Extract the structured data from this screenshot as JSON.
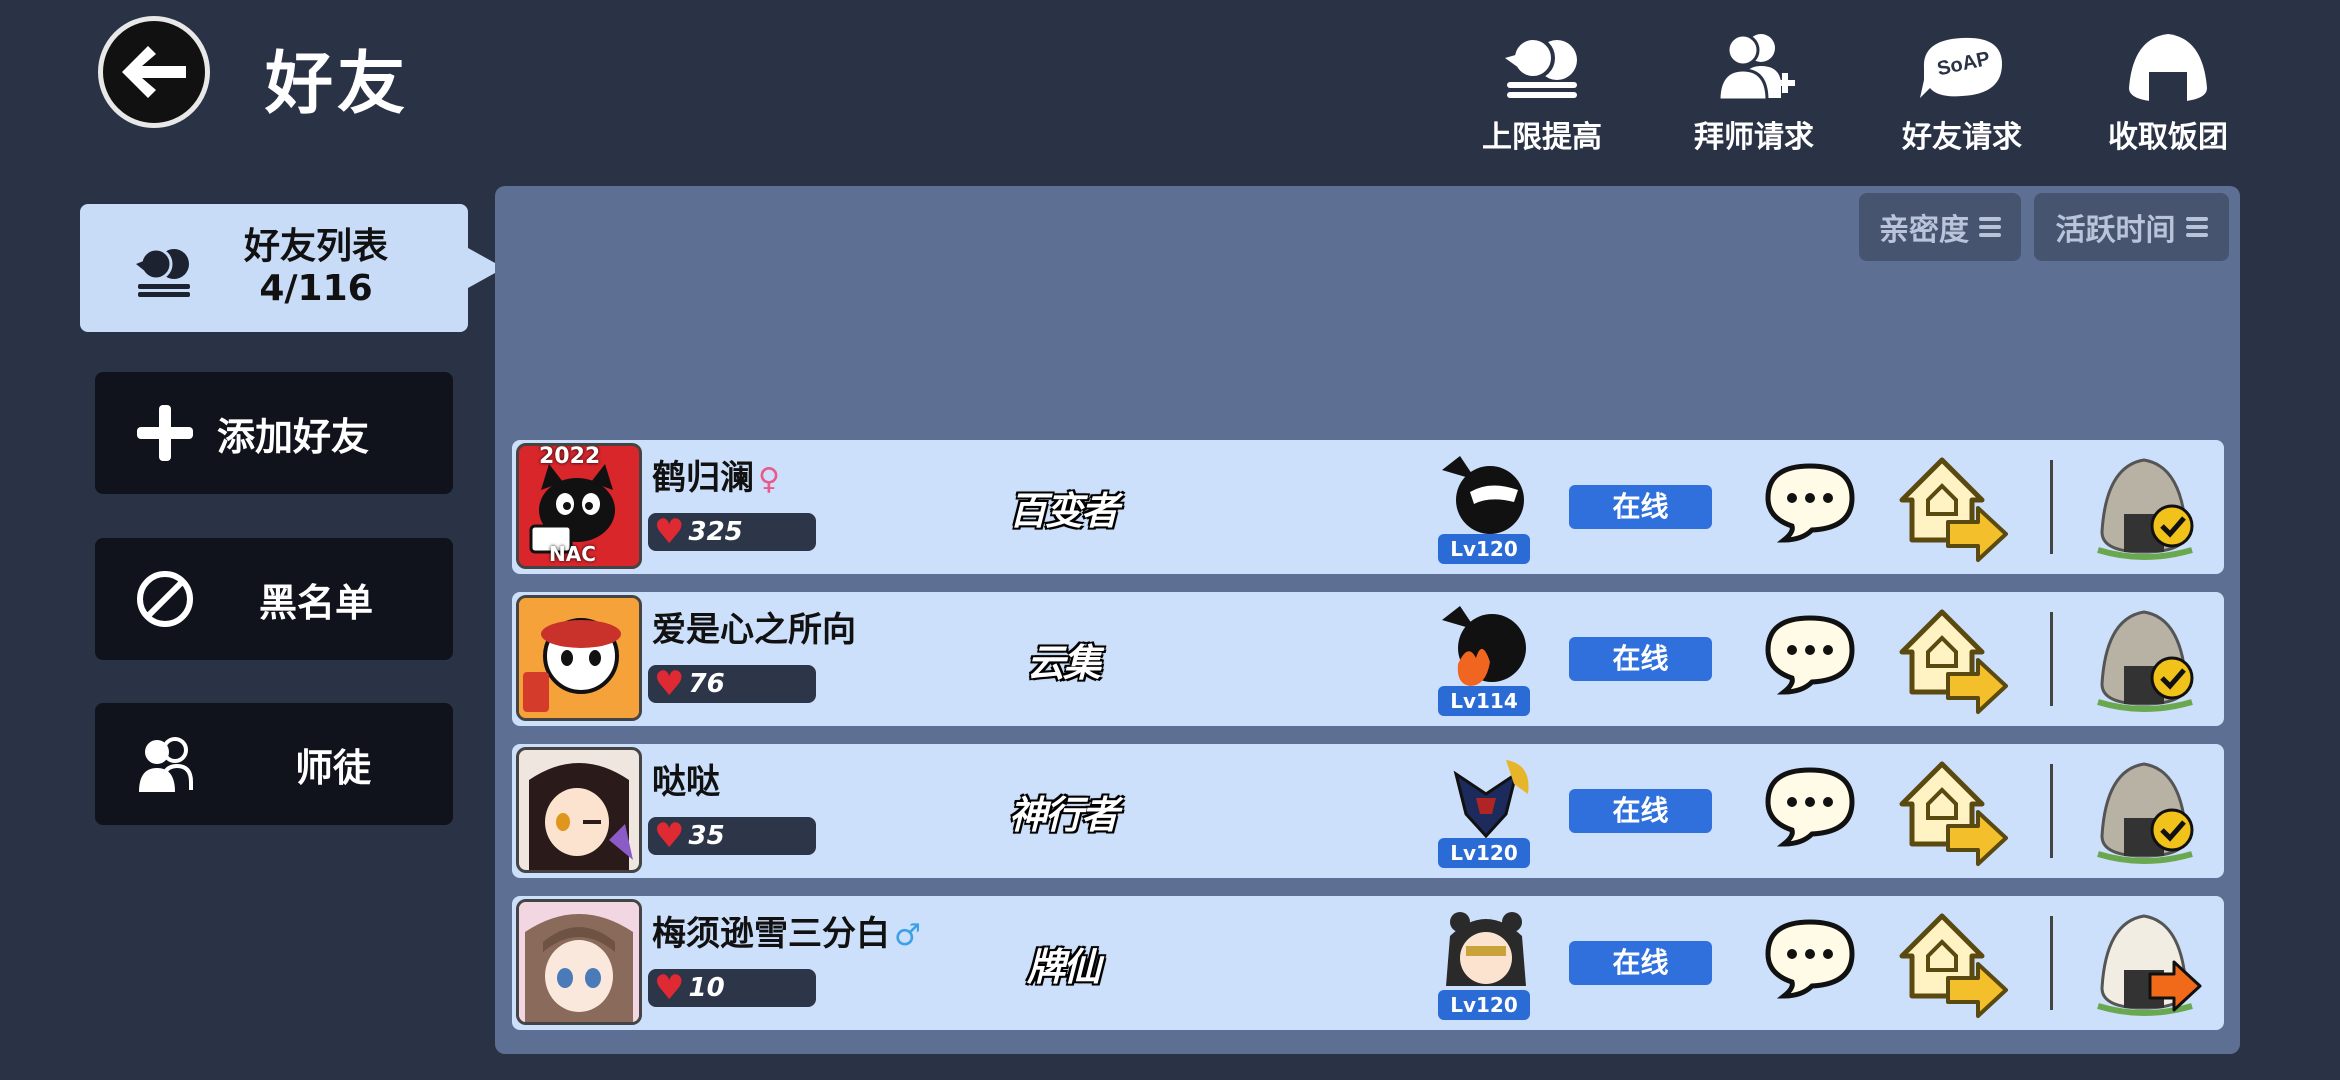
{
  "header": {
    "title": "好友"
  },
  "top_actions": [
    {
      "label": "上限提高",
      "icon": "friends-icon"
    },
    {
      "label": "拜师请求",
      "icon": "add-mentor-icon"
    },
    {
      "label": "好友请求",
      "icon": "soap-bubble-icon"
    },
    {
      "label": "收取饭团",
      "icon": "rice-ball-icon"
    }
  ],
  "soap_icon_text": "SoAP",
  "sidebar": {
    "friends_list": {
      "label": "好友列表",
      "count": "4/116"
    },
    "add_friend": "添加好友",
    "blacklist": "黑名单",
    "mentorship": "师徒"
  },
  "sort": {
    "intimacy": "亲密度",
    "active_time": "活跃时间"
  },
  "friends": [
    {
      "name": "鹤归澜",
      "gender": "♀",
      "gender_color": "#e85a8a",
      "intimacy": "325",
      "title": "百变者",
      "level": "Lv120",
      "status": "在线",
      "rice_state": "collected",
      "avatar_badge": "2022",
      "avatar_tag": "NAC",
      "avatar_bg": "#d8262b"
    },
    {
      "name": "爱是心之所向",
      "gender": "",
      "gender_color": "",
      "intimacy": "76",
      "title": "云集",
      "level": "Lv114",
      "status": "在线",
      "rice_state": "collected",
      "avatar_badge": "",
      "avatar_tag": "",
      "avatar_bg": "#f08a20"
    },
    {
      "name": "哒哒",
      "gender": "",
      "gender_color": "",
      "intimacy": "35",
      "title": "神行者",
      "level": "Lv120",
      "status": "在线",
      "rice_state": "collected",
      "avatar_badge": "",
      "avatar_tag": "",
      "avatar_bg": "#3b2a2a"
    },
    {
      "name": "梅须逊雪三分白",
      "gender": "♂",
      "gender_color": "#3aa0e8",
      "intimacy": "10",
      "title": "牌仙",
      "level": "Lv120",
      "status": "在线",
      "rice_state": "send",
      "avatar_badge": "",
      "avatar_tag": "",
      "avatar_bg": "#e9c7d6"
    }
  ]
}
